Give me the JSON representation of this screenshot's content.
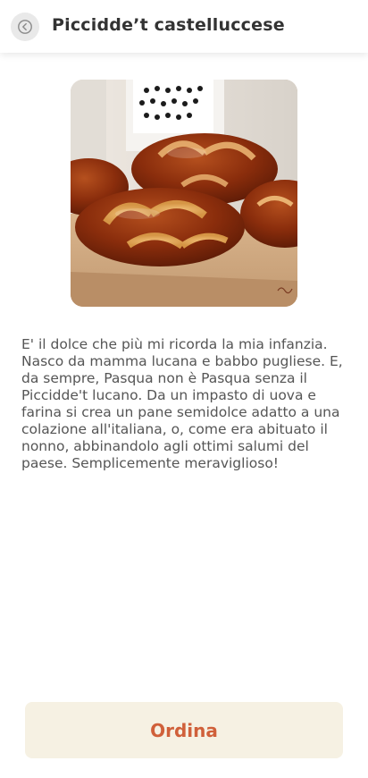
{
  "header": {
    "title": "Piccidde’t castelluccese",
    "back_icon": "back-arrow-circle-icon"
  },
  "product": {
    "image_subject": "braided sweet Easter bread loaves on a wooden board",
    "description": "E' il dolce che più mi ricorda la mia infanzia. Nasco da mamma lucana e babbo pugliese. E, da sempre, Pasqua non è Pasqua senza il Piccidde't lucano. Da un impasto di uova e farina si crea un pane semidolce adatto a una colazione all'italiana, o, come era abituato il nonno, abbinandolo agli ottimi salumi del paese. Semplicemente meraviglioso!"
  },
  "actions": {
    "order_label": "Ordina"
  },
  "colors": {
    "accent": "#d0603a",
    "button_bg": "#f6f1e3",
    "text": "#555555"
  }
}
